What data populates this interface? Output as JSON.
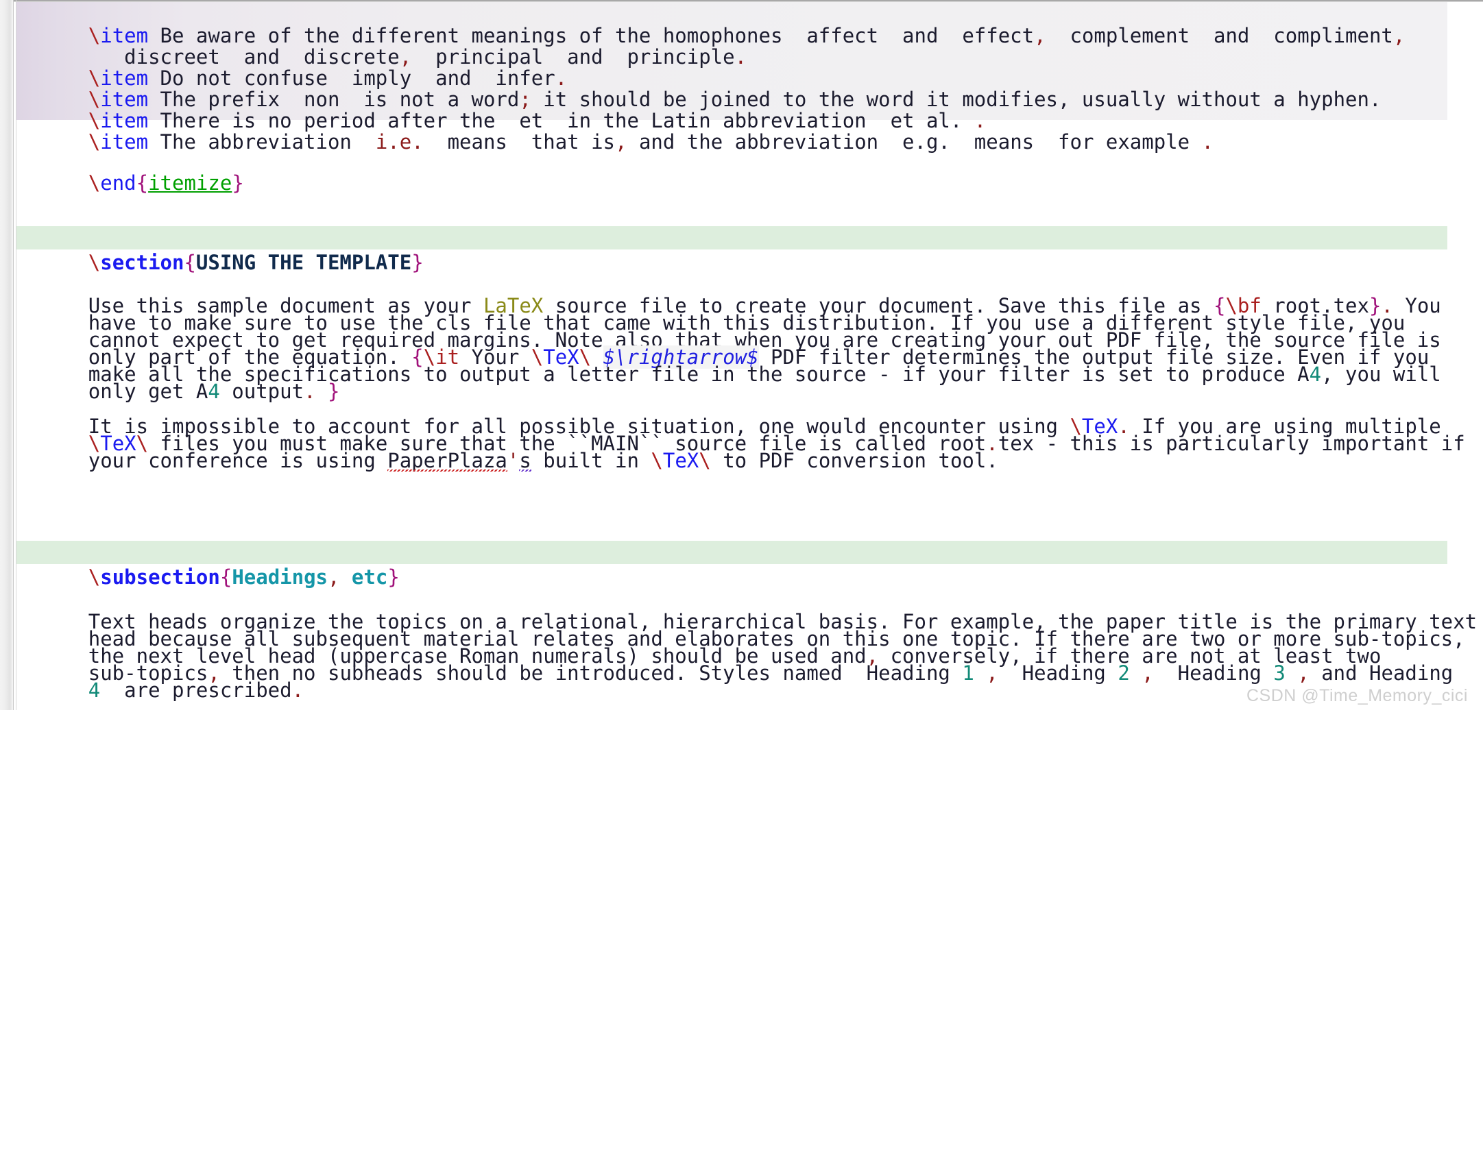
{
  "editor": {
    "app": "latex-source-editor",
    "watermark": "CSDN @Time_Memory_cici",
    "colors": {
      "backslash": "#aa2020",
      "command": "#1a1af0",
      "brace": "#a0117a",
      "environment": "#00a000",
      "section_arg": "#102a4c",
      "subsection_arg": "#1596a8",
      "punctuation": "#8b1a1a",
      "number": "#128a78",
      "latex_word": "#8a8a18",
      "math": "#2020e0",
      "selection_bg": "#ece8ee",
      "heading_bg": "#ddeedd",
      "page_bg": "#ffffff"
    }
  },
  "lines": {
    "l1_cmd_bs": "\\",
    "l1_cmd": "item",
    "l1_a": " Be aware of the different meanings of the homophones  affect  and  effect",
    "l1_comma1": ",",
    "l1_b": "  complement  and  compliment",
    "l1_comma2": ",",
    "l2_a": "   discreet  and  discrete",
    "l2_comma": ",",
    "l2_b": "  principal  and  principle",
    "l2_period": ".",
    "l3_cmd_bs": "\\",
    "l3_cmd": "item",
    "l3_a": " Do not confuse  imply  and  infer",
    "l3_period": ".",
    "l4_cmd_bs": "\\",
    "l4_cmd": "item",
    "l4_a": " The prefix  non  is not a word",
    "l4_semi": ";",
    "l4_b": " it should be joined to the word it modifies, usually without a hyphen.",
    "l5_cmd_bs": "\\",
    "l5_cmd": "item",
    "l5_a": " There is no period after the  et  in the Latin abbreviation  et al.",
    "l5_period": " .",
    "l6_cmd_bs": "\\",
    "l6_cmd": "item",
    "l6_a": " The abbreviation  ",
    "l6_ie": "i.e.",
    "l6_b": "  means  that is",
    "l6_comma": ",",
    "l6_c": " and the abbreviation  e.g.  means  for example",
    "l6_period": " .",
    "end_bs": "\\",
    "end_cmd": "end",
    "end_obrace": "{",
    "end_env": "itemize",
    "end_cbrace": "}",
    "sec_bs": "\\",
    "sec_cmd": "section",
    "sec_obrace": "{",
    "sec_arg": "USING THE TEMPLATE",
    "sec_cbrace": "}",
    "p1_l1_a": "Use this sample document as your ",
    "p1_l1_latex": "LaTeX",
    "p1_l1_b": " source file to create your document. Save this file as ",
    "p1_l1_obrace": "{",
    "p1_l1_bs": "\\",
    "p1_l1_bf": "bf",
    "p1_l1_file": " root.tex",
    "p1_l1_cbrace": "}",
    "p1_l1_dot": ".",
    "p1_l1_c": " You",
    "p1_l2": "have to make sure to use the cls file that came with this distribution. If you use a different style file, you",
    "p1_l3": "cannot expect to get required margins. Note also that when you are creating your out PDF file, the source file is",
    "p1_l4_a": "only part of the equation. ",
    "p1_l4_obrace": "{",
    "p1_l4_bs": "\\",
    "p1_l4_it": "it",
    "p1_l4_b": " Your ",
    "p1_l4_texbs1": "\\",
    "p1_l4_tex": "TeX",
    "p1_l4_texbs2": "\\",
    "p1_l4_math": "$\\rightarrow$",
    "p1_l4_c": " PDF filter determines the output file size. Even if you",
    "p1_l5": "make all the specifications to output a letter file in the source - if your filter is set to produce A",
    "p1_l5_num": "4",
    "p1_l5_b": ", you will",
    "p1_l6_a": "only get A",
    "p1_l6_num": "4",
    "p1_l6_b": " output",
    "p1_l6_dot": ".",
    "p1_l6_cbrace": " }",
    "p2_l1_a": "It is impossible to account for all possible situation, one would encounter using ",
    "p2_l1_bs": "\\",
    "p2_l1_tex": "TeX",
    "p2_l1_dot": ".",
    "p2_l1_b": " If you are using multiple",
    "p2_l2_bs": "\\",
    "p2_l2_tex": "TeX",
    "p2_l2_bs2": "\\",
    "p2_l2_a": " files you must make sure that the ``MAIN`` source file is called root",
    "p2_l2_dot": ".",
    "p2_l2_b": "tex - this is particularly important if",
    "p2_l3_a": "your conference is using ",
    "p2_l3_paper": "PaperPlaza",
    "p2_l3_apos": "'",
    "p2_l3_s": "s",
    "p2_l3_b": " built in ",
    "p2_l3_bs": "\\",
    "p2_l3_tex": "TeX",
    "p2_l3_bs2": "\\",
    "p2_l3_c": " to PDF conversion tool.",
    "sub_bs": "\\",
    "sub_cmd": "subsection",
    "sub_obrace": "{",
    "sub_arg1": "Headings",
    "sub_comma": ",",
    "sub_arg2": " etc",
    "sub_cbrace": "}",
    "p3_l1": "Text heads organize the topics on a relational, hierarchical basis. For example, the paper title is the primary text",
    "p3_l2": "head because all subsequent material relates and elaborates on this one topic. If there are two or more sub-topics,",
    "p3_l3_a": "the next level head (uppercase Roman numerals) should be used and",
    "p3_l3_comma": ",",
    "p3_l3_b": " conversely, if there are not at least two",
    "p3_l4_a": "sub-topics",
    "p3_l4_comma": ",",
    "p3_l4_b": " then no subheads should be introduced. Styles named  Heading ",
    "p3_l4_n1": "1",
    "p3_l4_c1": " ,",
    "p3_l4_c": "  Heading ",
    "p3_l4_n2": "2",
    "p3_l4_c2": " ,",
    "p3_l4_d": "  Heading ",
    "p3_l4_n3": "3",
    "p3_l4_c3": " ,",
    "p3_l4_e": " and Heading",
    "p3_l5_n4": "4",
    "p3_l5_a": "  are prescribed",
    "p3_l5_dot": "."
  }
}
